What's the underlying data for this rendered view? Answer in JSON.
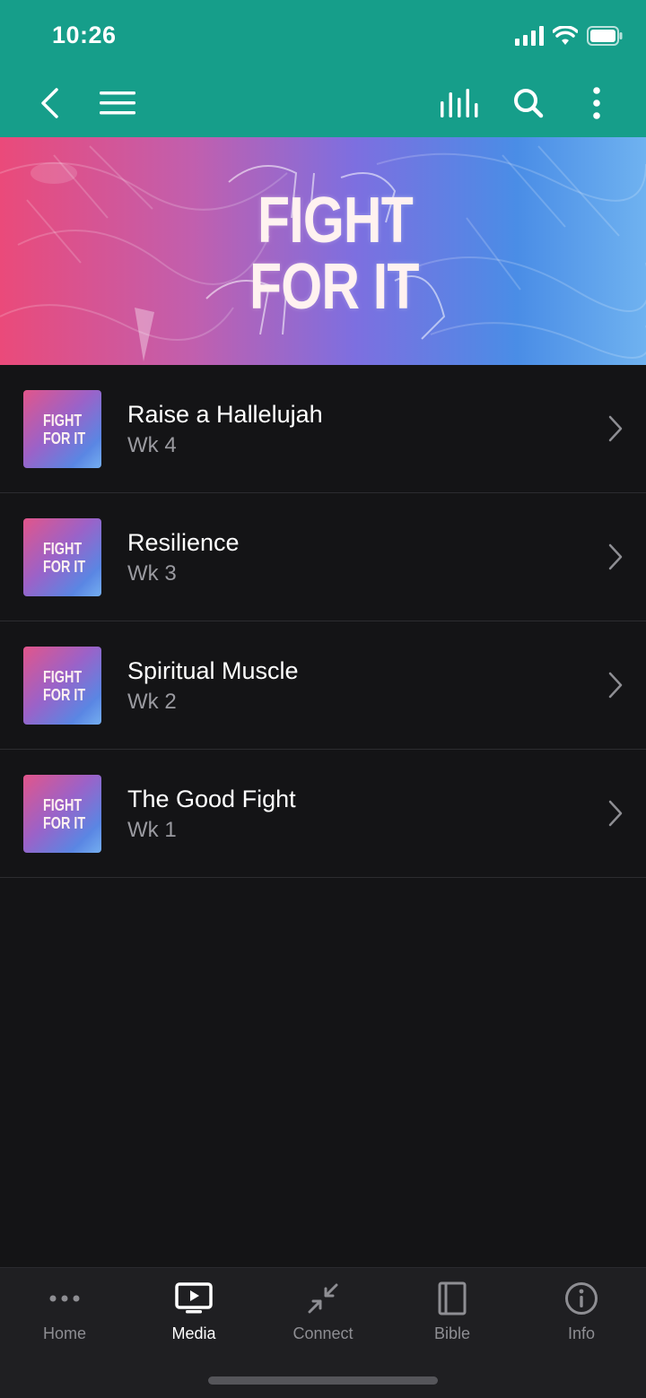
{
  "status_bar": {
    "time": "10:26"
  },
  "banner": {
    "line1": "FIGHT",
    "line2": "FOR IT"
  },
  "thumb_text": {
    "line1": "FIGHT",
    "line2": "FOR IT"
  },
  "sermons": [
    {
      "title": "Raise a Hallelujah",
      "subtitle": "Wk 4"
    },
    {
      "title": "Resilience",
      "subtitle": "Wk 3"
    },
    {
      "title": "Spiritual Muscle",
      "subtitle": "Wk 2"
    },
    {
      "title": "The Good Fight",
      "subtitle": "Wk 1"
    }
  ],
  "tabs": [
    {
      "label": "Home",
      "icon": "more-dots-icon",
      "active": false
    },
    {
      "label": "Media",
      "icon": "tv-play-icon",
      "active": true
    },
    {
      "label": "Connect",
      "icon": "connect-arrows-icon",
      "active": false
    },
    {
      "label": "Bible",
      "icon": "book-icon",
      "active": false
    },
    {
      "label": "Info",
      "icon": "info-icon",
      "active": false
    }
  ],
  "colors": {
    "header": "#169e8a",
    "background": "#141416",
    "tabbar": "#1f1f22"
  }
}
